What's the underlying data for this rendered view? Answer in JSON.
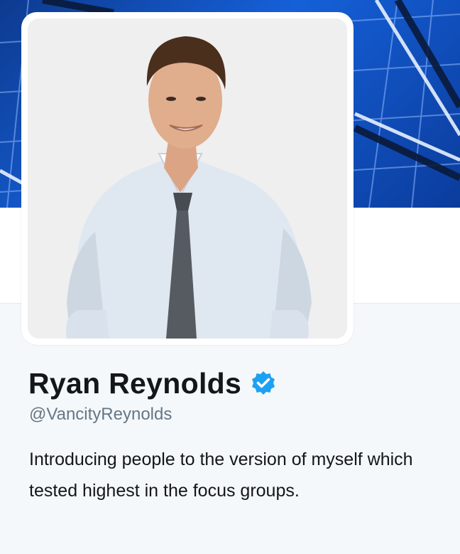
{
  "profile": {
    "name": "Ryan Reynolds",
    "handle": "@VancityReynolds",
    "bio": "Introducing people to the version of myself which tested highest in the focus groups.",
    "verified": true
  },
  "icons": {
    "verified_badge": "verified-badge-icon"
  },
  "colors": {
    "banner_blue": "#1560d8",
    "verified_blue": "#1da1f2",
    "name_text": "#14171a",
    "handle_text": "#657786",
    "page_background": "#f5f8fa"
  }
}
